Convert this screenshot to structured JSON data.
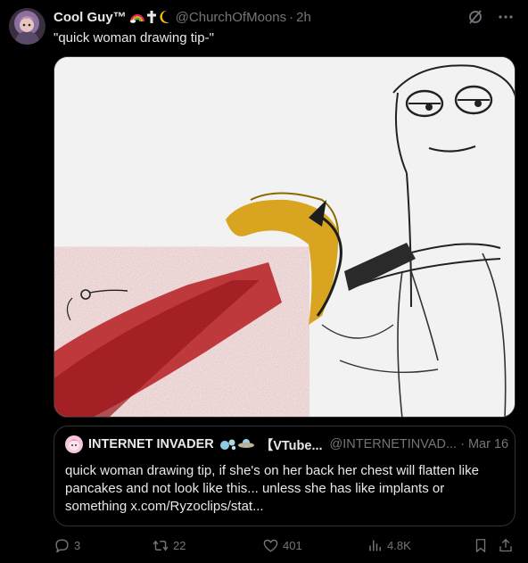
{
  "post": {
    "display_name": "Cool Guy™",
    "handle": "@ChurchOfMoons",
    "separator": "·",
    "time": "2h",
    "text": "\"quick woman drawing tip-\""
  },
  "quote": {
    "display_name": "INTERNET INVADER",
    "display_name_2": "【VTube...",
    "handle": "@INTERNETINVAD... · Mar 16",
    "text": "quick woman drawing tip, if she's on her back her chest will flatten like pancakes and not look like this... unless she has like implants or something x.com/Ryzoclips/stat..."
  },
  "actions": {
    "replies": "3",
    "reposts": "22",
    "likes": "401",
    "views": "4.8K"
  },
  "icons": {
    "name_emoji": [
      "rainbow-icon",
      "cross-icon",
      "moon-icon"
    ],
    "quote_emoji": [
      "bubbles-icon",
      "ufo-icon"
    ],
    "header": [
      "grok-icon",
      "more-icon"
    ],
    "actions": [
      "reply-icon",
      "repost-icon",
      "like-icon",
      "views-icon",
      "bookmark-icon",
      "share-icon"
    ]
  },
  "colors": {
    "background": "#000000",
    "text": "#e7e9ea",
    "muted": "#71767b",
    "border": "#2f3336",
    "blood": "#b3171c",
    "hair": "#d9a520"
  }
}
